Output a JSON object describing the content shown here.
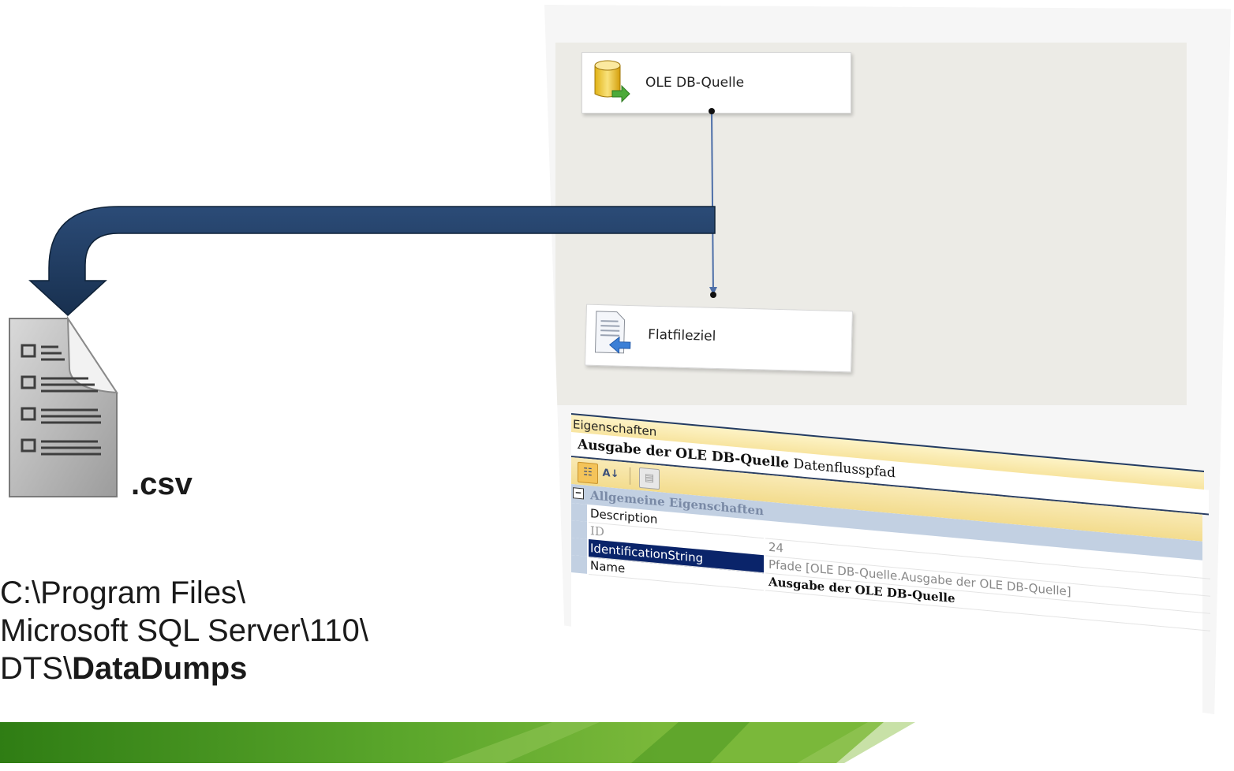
{
  "file": {
    "extension": ".csv",
    "path_line1": "C:\\Program Files\\",
    "path_line2": "Microsoft SQL Server\\110\\",
    "path_line3_prefix": "DTS\\",
    "path_line3_bold": "DataDumps"
  },
  "dataflow": {
    "source_component": "OLE DB-Quelle",
    "destination_component": "Flatfileziel"
  },
  "properties": {
    "panel_title": "Eigenschaften",
    "object_name": "Ausgabe der OLE DB-Quelle",
    "object_type": "Datenflusspfad",
    "category": "Allgemeine Eigenschaften",
    "rows": [
      {
        "name": "Description",
        "value": ""
      },
      {
        "name": "ID",
        "value": "24"
      },
      {
        "name": "IdentificationString",
        "value": "Pfade [OLE DB-Quelle.Ausgabe der OLE DB-Quelle]"
      },
      {
        "name": "Name",
        "value": "Ausgabe der OLE DB-Quelle"
      }
    ]
  },
  "colors": {
    "arrow": "#1f3a5f",
    "selection": "#0a246a",
    "footer_green": "#3f8f1f"
  },
  "icons": [
    "document-list-icon",
    "database-source-icon",
    "flat-file-destination-icon",
    "categorized-icon",
    "alphabetical-sort-icon",
    "property-pages-icon",
    "collapse-icon"
  ]
}
